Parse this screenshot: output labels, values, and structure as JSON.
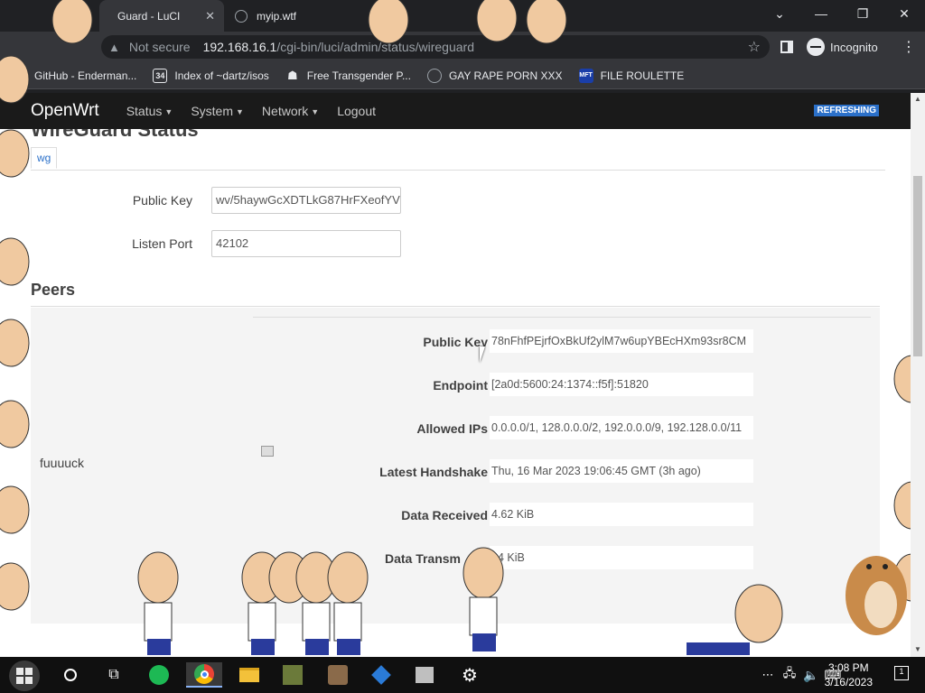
{
  "browser": {
    "tabs": [
      {
        "title": "Guard - LuCI",
        "active": true
      },
      {
        "title": "myip.wtf",
        "active": false
      }
    ],
    "security_label": "Not secure",
    "url_host": "192.168.16.1",
    "url_path": "/cgi-bin/luci/admin/status/wireguard",
    "incognito_label": "Incognito",
    "bookmarks": [
      {
        "label": "GitHub - Enderman...",
        "icon": "github-icon"
      },
      {
        "label": "Index of ~dartz/isos",
        "icon": "site-34-icon"
      },
      {
        "label": "Free Transgender P...",
        "icon": "mask-icon"
      },
      {
        "label": "GAY RAPE PORN XXX",
        "icon": "globe-icon"
      },
      {
        "label": "FILE ROULETTE",
        "icon": "mft-icon"
      }
    ],
    "window_controls": {
      "chevron": "⌄",
      "minimize": "—",
      "restore": "❐",
      "close": "✕"
    }
  },
  "page": {
    "brand": "OpenWrt",
    "nav": [
      {
        "label": "Status"
      },
      {
        "label": "System"
      },
      {
        "label": "Network"
      },
      {
        "label": "Logout"
      }
    ],
    "refresh_badge": "REFRESHING",
    "heading": "WireGuard Status",
    "subtab": "wg",
    "interface": {
      "public_key_label": "Public Key",
      "public_key_value": "wv/5haywGcXDTLkG87HrFXeofYV",
      "listen_port_label": "Listen Port",
      "listen_port_value": "42102"
    },
    "peers_heading": "Peers",
    "peer": {
      "name": "fuuuuck",
      "rows": [
        {
          "label": "Public Key",
          "value": "78nFhfPEjrfOxBkUf2ylM7w6upYBEcHXm93sr8CM"
        },
        {
          "label": "Endpoint",
          "value": "[2a0d:5600:24:1374::f5f]:51820"
        },
        {
          "label": "Allowed IPs",
          "value": "0.0.0.0/1, 128.0.0.0/2, 192.0.0.0/9, 192.128.0.0/11"
        },
        {
          "label": "Latest Handshake",
          "value": "Thu, 16 Mar 2023 19:06:45 GMT (3h ago)"
        },
        {
          "label": "Data Received",
          "value": "4.62 KiB"
        },
        {
          "label": "Data Transm",
          "value": "44 KiB"
        }
      ]
    }
  },
  "taskbar": {
    "time": "3:08 PM",
    "date": "3/16/2023",
    "notification_count": "1"
  }
}
